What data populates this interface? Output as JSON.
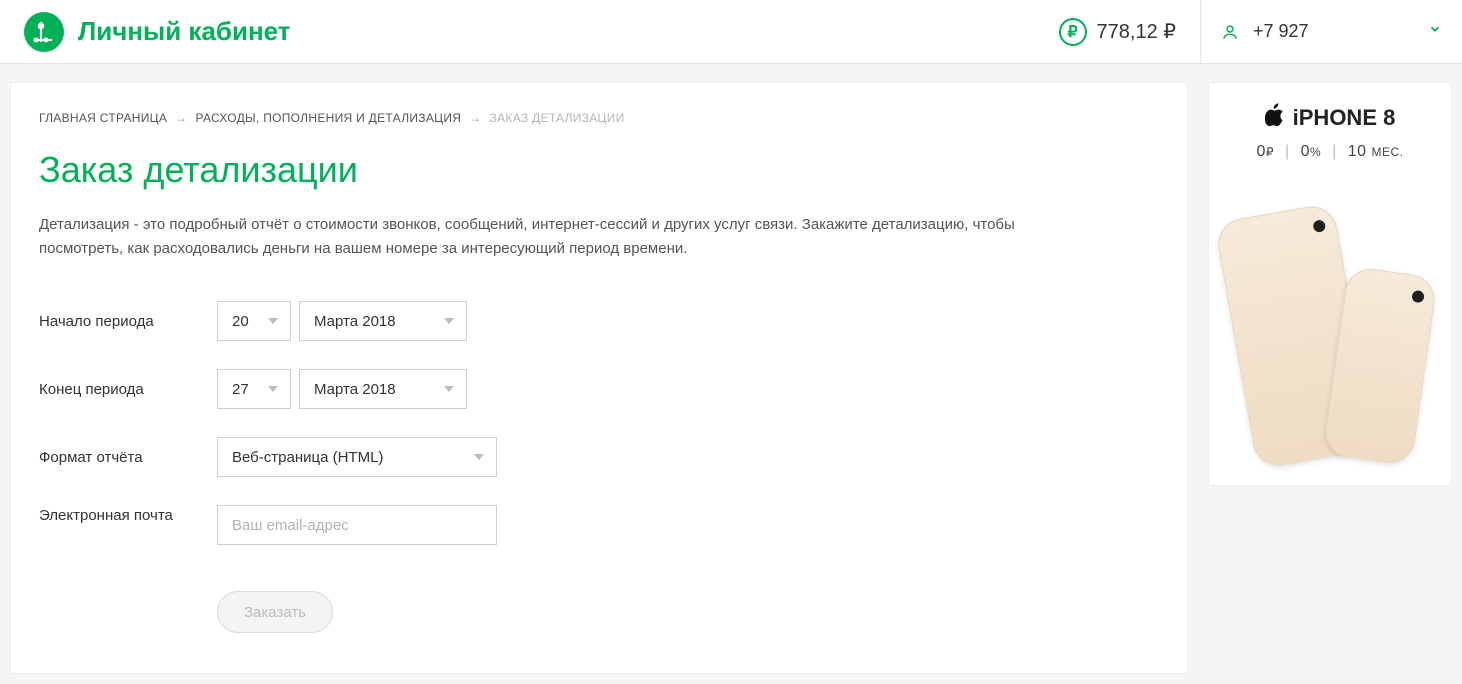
{
  "header": {
    "title": "Личный кабинет",
    "balance": "778,12 ₽",
    "phone": "+7 927"
  },
  "breadcrumbs": {
    "home": "ГЛАВНАЯ СТРАНИЦА",
    "section": "РАСХОДЫ, ПОПОЛНЕНИЯ И ДЕТАЛИЗАЦИЯ",
    "current": "ЗАКАЗ ДЕТАЛИЗАЦИИ"
  },
  "page": {
    "title": "Заказ детализации",
    "description": "Детализация - это подробный отчёт о стоимости звонков, сообщений, интернет-сессий и других услуг связи. Закажите детализацию, чтобы посмотреть, как расходовались деньги на вашем номере за интересующий период времени."
  },
  "form": {
    "start_label": "Начало периода",
    "start_day": "20",
    "start_month": "Марта 2018",
    "end_label": "Конец периода",
    "end_day": "27",
    "end_month": "Марта 2018",
    "format_label": "Формат отчёта",
    "format_value": "Веб-страница (HTML)",
    "email_label": "Электронная почта",
    "email_placeholder": "Ваш email-адрес",
    "submit": "Заказать"
  },
  "ad": {
    "title": "iPHONE 8",
    "price": "0",
    "currency": "₽",
    "percent": "0",
    "percent_sym": "%",
    "months": "10",
    "months_label": "МЕС."
  }
}
